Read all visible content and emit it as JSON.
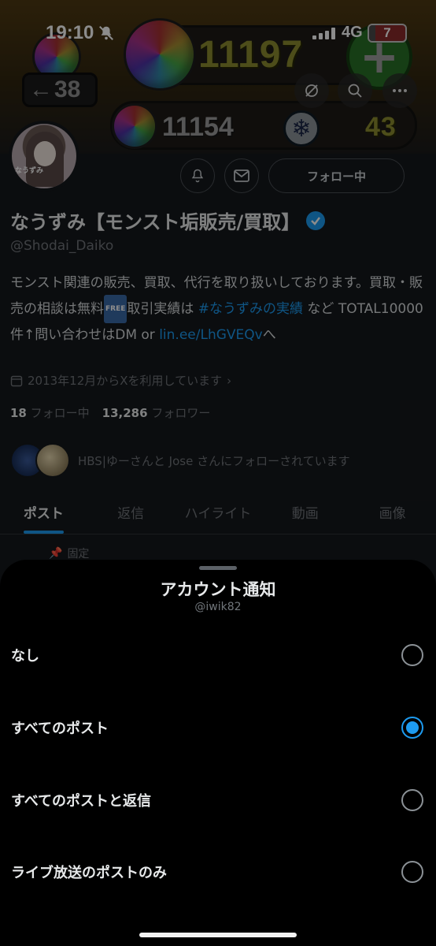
{
  "status_bar": {
    "time": "19:10",
    "network": "4G",
    "battery": "7"
  },
  "banner": {
    "badge_number": "38",
    "orb_count_main": "11197",
    "orb_count_secondary": "11154",
    "stamina": "43",
    "plus_symbol": "+",
    "snow_symbol": "❄"
  },
  "profile": {
    "display_name": "なうずみ【モンスト垢販売/買取】",
    "handle": "@Shodai_Daiko",
    "avatar_text": "なうずみ",
    "follow_button": "フォロー中",
    "bio": {
      "part1": "モンスト関連の販売、買取、代行を取り扱いしております。買取・販売の相談は無料",
      "free_badge": "FREE",
      "part2": "取引実績は ",
      "hashtag": "#なうずみの実績",
      "part3": " など TOTAL10000 件↑問い合わせはDM or ",
      "link": "lin.ee/LhGVEQv",
      "part4": "へ"
    },
    "joined": "2013年12月からXを利用しています",
    "following_count": "18",
    "following_label": "フォロー中",
    "followers_count": "13,286",
    "followers_label": "フォロワー",
    "followed_by": "HBS|ゆーさんと Jose さんにフォローされています",
    "pinned_label": "固定"
  },
  "tabs": [
    {
      "label": "ポスト",
      "active": true
    },
    {
      "label": "返信",
      "active": false
    },
    {
      "label": "ハイライト",
      "active": false
    },
    {
      "label": "動画",
      "active": false
    },
    {
      "label": "画像",
      "active": false
    }
  ],
  "sheet": {
    "title": "アカウント通知",
    "subtitle": "@iwik82",
    "options": [
      {
        "label": "なし",
        "selected": false
      },
      {
        "label": "すべてのポスト",
        "selected": true
      },
      {
        "label": "すべてのポストと返信",
        "selected": false
      },
      {
        "label": "ライブ放送のポストのみ",
        "selected": false
      }
    ]
  },
  "colors": {
    "accent": "#1d9bf0",
    "background": "#000000",
    "muted_text": "#71767b"
  }
}
